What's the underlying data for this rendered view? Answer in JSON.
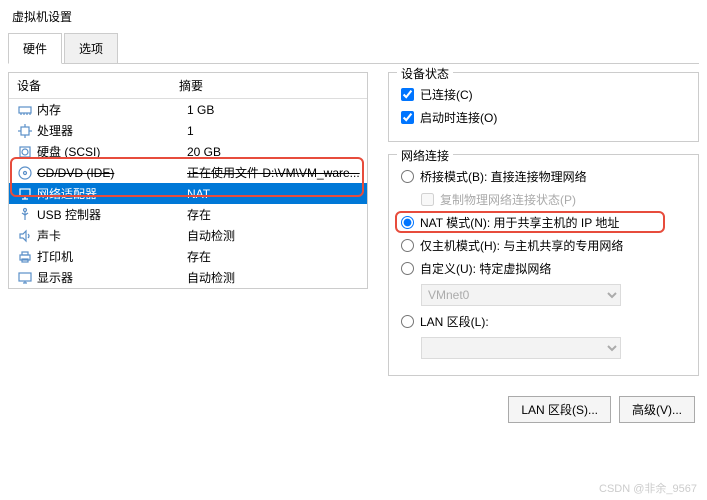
{
  "window": {
    "title": "虚拟机设置"
  },
  "tabs": [
    {
      "label": "硬件",
      "active": true
    },
    {
      "label": "选项",
      "active": false
    }
  ],
  "table": {
    "header_device": "设备",
    "header_summary": "摘要"
  },
  "devices": [
    {
      "name": "内存",
      "summary": "1 GB",
      "icon": "memory"
    },
    {
      "name": "处理器",
      "summary": "1",
      "icon": "cpu"
    },
    {
      "name": "硬盘 (SCSI)",
      "summary": "20 GB",
      "icon": "disk"
    },
    {
      "name": "CD/DVD (IDE)",
      "summary": "正在使用文件 D:\\VM\\VM_ware...",
      "icon": "cd",
      "strike": true
    },
    {
      "name": "网络适配器",
      "summary": "NAT",
      "icon": "network",
      "selected": true
    },
    {
      "name": "USB 控制器",
      "summary": "存在",
      "icon": "usb"
    },
    {
      "name": "声卡",
      "summary": "自动检测",
      "icon": "sound"
    },
    {
      "name": "打印机",
      "summary": "存在",
      "icon": "printer"
    },
    {
      "name": "显示器",
      "summary": "自动检测",
      "icon": "display"
    }
  ],
  "status": {
    "legend": "设备状态",
    "connected": "已连接(C)",
    "connect_on_start": "启动时连接(O)"
  },
  "network": {
    "legend": "网络连接",
    "bridge": "桥接模式(B): 直接连接物理网络",
    "replicate": "复制物理网络连接状态(P)",
    "nat": "NAT 模式(N): 用于共享主机的 IP 地址",
    "hostonly": "仅主机模式(H): 与主机共享的专用网络",
    "custom": "自定义(U): 特定虚拟网络",
    "vmnet": "VMnet0",
    "lan_segment": "LAN 区段(L):"
  },
  "buttons": {
    "lan": "LAN 区段(S)...",
    "advanced": "高级(V)..."
  },
  "watermark": "CSDN @非余_9567"
}
